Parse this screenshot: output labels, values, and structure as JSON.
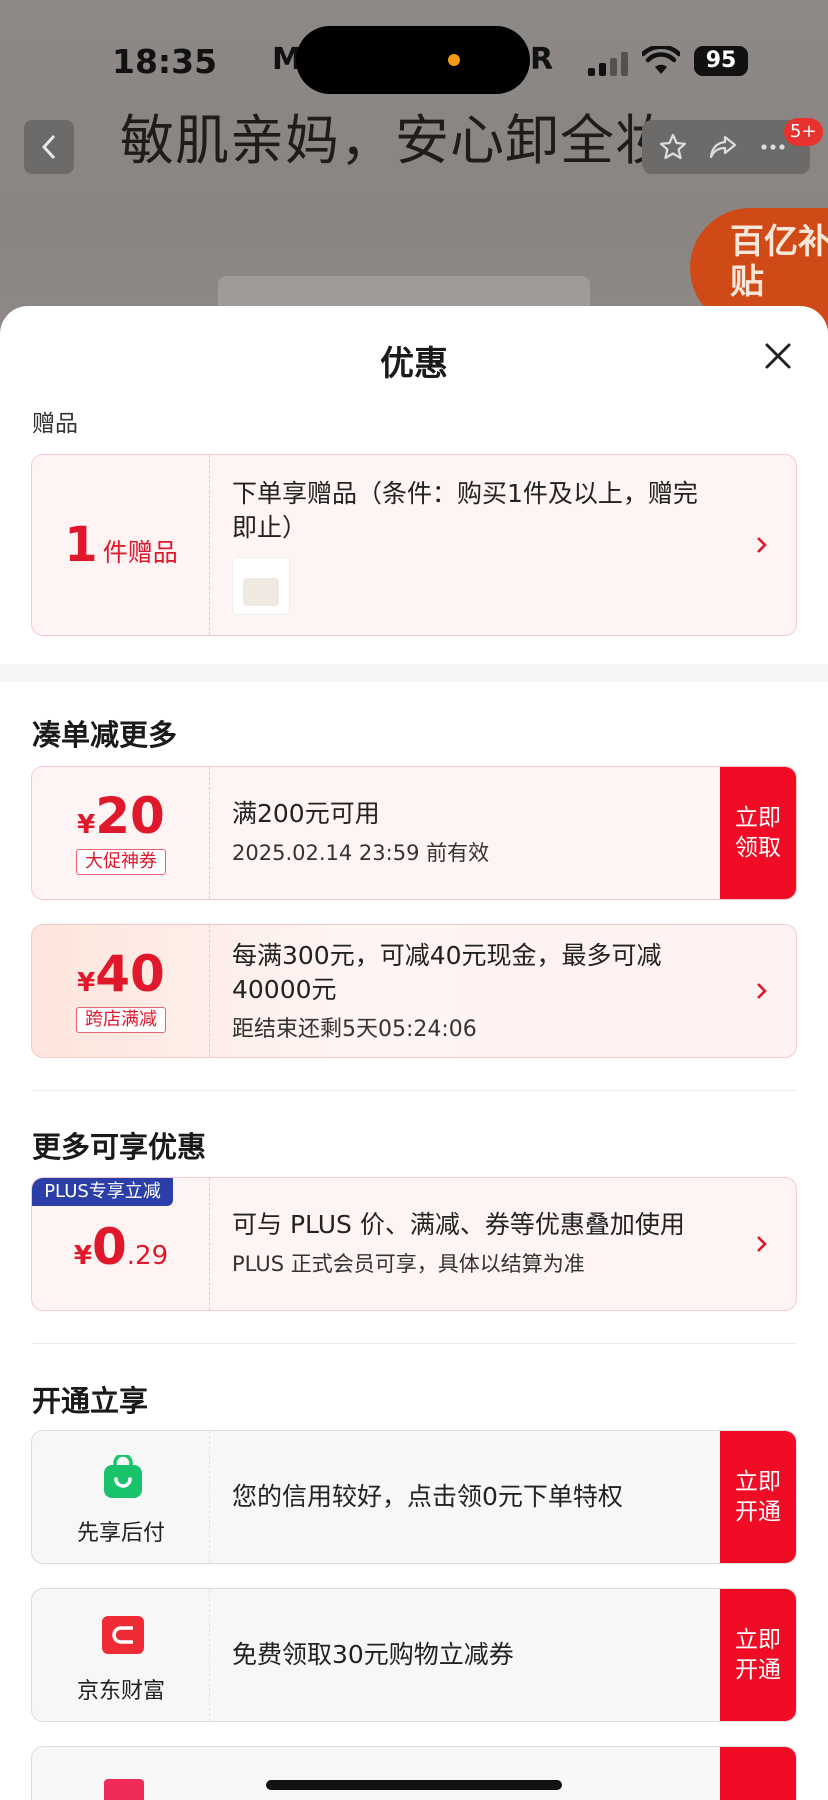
{
  "status_bar": {
    "time": "18:35",
    "carrier_left": "M",
    "carrier_right": "R",
    "battery": "95"
  },
  "product_page": {
    "heading": "敏肌亲妈，安心卸全妆。",
    "notification_badge": "5+",
    "subsidy_badge": "百亿补贴"
  },
  "sheet": {
    "title": "优惠",
    "gift_section": {
      "label": "赠品",
      "count": "1",
      "unit": "件赠品",
      "description": "下单享赠品（条件：购买1件及以上，赠完即止）"
    },
    "more_discount_section": {
      "title": "凑单减更多",
      "coupons": [
        {
          "currency": "¥",
          "amount": "20",
          "tag": "大促神券",
          "line1": "满200元可用",
          "line2": "2025.02.14 23:59 前有效",
          "cta": "立即领取"
        },
        {
          "currency": "¥",
          "amount": "40",
          "tag": "跨店满减",
          "line1": "每满300元，可减40元现金，最多可减40000元",
          "line2": "距结束还剩5天05:24:06"
        }
      ]
    },
    "extra_section": {
      "title": "更多可享优惠",
      "plus": {
        "corner_tag": "PLUS专享立减",
        "currency": "¥",
        "amount_int": "0",
        "amount_dec": ".29",
        "line1": "可与 PLUS 价、满减、券等优惠叠加使用",
        "line2": "PLUS 正式会员可享，具体以结算为准"
      }
    },
    "activate_section": {
      "title": "开通立享",
      "items": [
        {
          "name": "先享后付",
          "text": "您的信用较好，点击领0元下单特权",
          "cta": "立即开通",
          "icon": "shopping-bag-icon",
          "icon_color": "#19c36b"
        },
        {
          "name": "京东财富",
          "text": "免费领取30元购物立减券",
          "cta": "立即开通",
          "icon": "wallet-icon",
          "icon_color": "#ef2b36"
        }
      ]
    }
  },
  "colors": {
    "accent_red": "#ef0c24",
    "text_red": "#e0182c",
    "card_bg": "#fff4f4",
    "card_border": "#f7c9cd"
  }
}
